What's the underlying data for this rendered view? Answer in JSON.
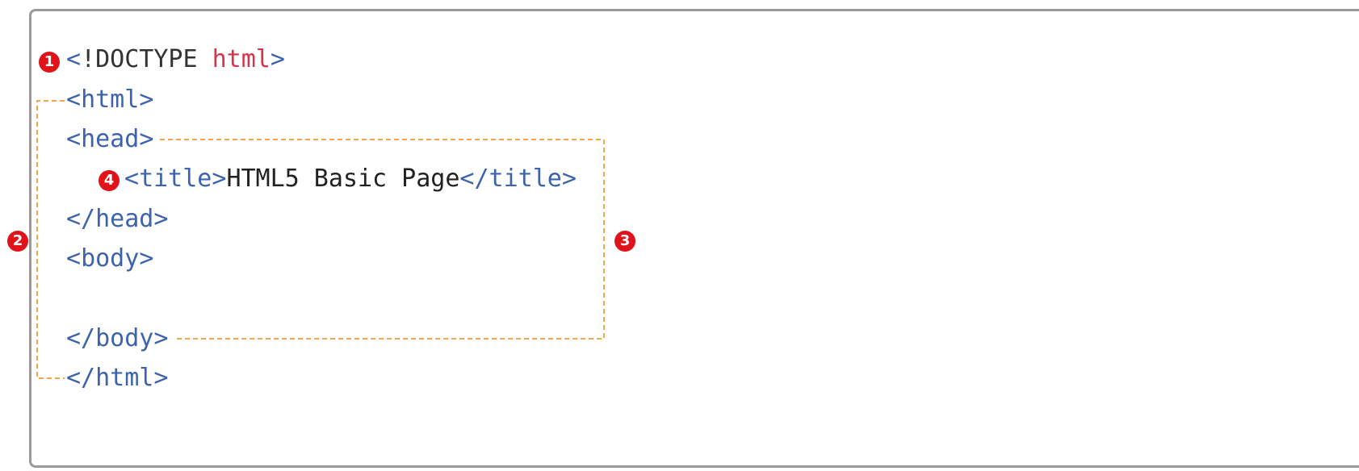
{
  "lines": [
    {
      "open": "<",
      "name": "!DOCTYPE",
      "attr": "html",
      "close": ">"
    },
    {
      "open": "<",
      "name": "html",
      "close": ">"
    },
    {
      "open": "<",
      "name": "head",
      "close": ">"
    },
    {
      "open": "<",
      "name": "title",
      "close": ">",
      "text": "HTML5 Basic Page",
      "end_open": "</",
      "end_name": "title",
      "end_close": ">"
    },
    {
      "open": "</",
      "name": "head",
      "close": ">"
    },
    {
      "open": "<",
      "name": "body",
      "close": ">"
    },
    {
      "open": "</",
      "name": "body",
      "close": ">"
    },
    {
      "open": "</",
      "name": "html",
      "close": ">"
    }
  ],
  "badges": [
    "1",
    "2",
    "3",
    "4"
  ],
  "colors": {
    "tag": "#3d63ad",
    "attr": "#d8334a",
    "badge": "#e0131a",
    "guide": "#f4a64a",
    "frame": "#9a9a9a"
  }
}
